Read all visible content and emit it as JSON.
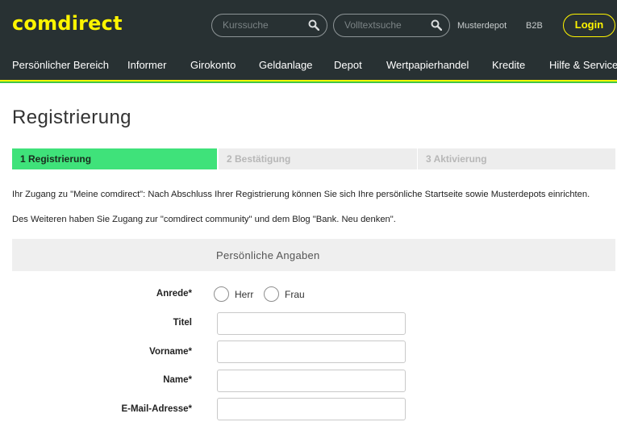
{
  "header": {
    "logo": "comdirect",
    "search1_placeholder": "Kurssuche",
    "search2_placeholder": "Volltextsuche",
    "links": [
      "Musterdepot",
      "B2B"
    ],
    "login_label": "Login"
  },
  "nav": {
    "items": [
      "Persönlicher Bereich",
      "Informer",
      "Girokonto",
      "Geldanlage",
      "Depot",
      "Wertpapierhandel",
      "Kredite",
      "Hilfe & Service"
    ]
  },
  "page": {
    "title": "Registrierung",
    "steps": [
      "1 Registrierung",
      "2 Bestätigung",
      "3 Aktivierung"
    ],
    "intro1": "Ihr Zugang zu \"Meine comdirect\": Nach Abschluss Ihrer Registrierung können Sie sich Ihre persönliche Startseite sowie Musterdepots einrichten.",
    "intro2": "Des Weiteren haben Sie Zugang zur \"comdirect community\" und dem Blog \"Bank. Neu denken\".",
    "section_title": "Persönliche Angaben"
  },
  "form": {
    "anrede_label": "Anrede*",
    "anrede_options": [
      "Herr",
      "Frau"
    ],
    "titel_label": "Titel",
    "vorname_label": "Vorname*",
    "name_label": "Name*",
    "email_label": "E-Mail-Adresse*"
  },
  "colors": {
    "header_bg": "#283133",
    "brand_yellow": "#fff500",
    "step_active": "#3fe27a"
  }
}
